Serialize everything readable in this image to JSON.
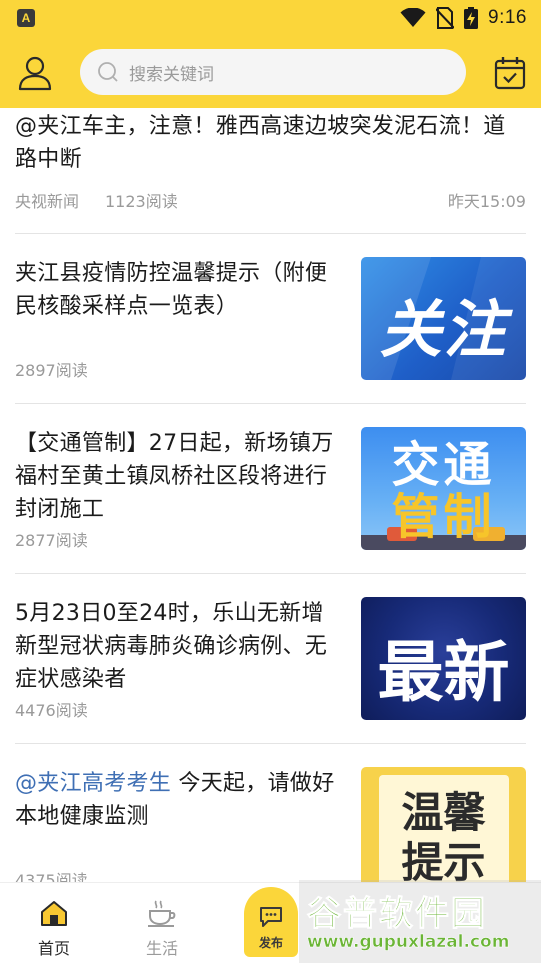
{
  "status_bar": {
    "app_icon_letter": "A",
    "time": "9:16",
    "icons": [
      "wifi-icon",
      "no-sim-icon",
      "battery-charging-icon"
    ]
  },
  "header": {
    "search_placeholder": "搜索关键词"
  },
  "news": [
    {
      "title": "@夹江车主，注意！雅西高速边坡突发泥石流！道路中断",
      "source": "央视新闻",
      "reads": "1123阅读",
      "time": "昨天15:09"
    },
    {
      "title": "夹江县疫情防控温馨提示（附便民核酸采样点一览表）",
      "reads": "2897阅读",
      "thumb_text": "关注"
    },
    {
      "title": "【交通管制】27日起，新场镇万福村至黄土镇凤桥社区段将进行封闭施工",
      "reads": "2877阅读",
      "thumb_line1": "交通",
      "thumb_line2": "管制"
    },
    {
      "title": "5月23日0至24时，乐山无新增新型冠状病毒肺炎确诊病例、无症状感染者",
      "reads": "4476阅读",
      "thumb_text": "最新"
    },
    {
      "title_tag": "@夹江高考考生",
      "title_rest": " 今天起，请做好本地健康监测",
      "reads": "4375阅读",
      "thumb_line1": "温馨",
      "thumb_line2": "提示"
    }
  ],
  "bottom_nav": {
    "items": [
      {
        "label": "首页",
        "icon": "home-icon",
        "active": true
      },
      {
        "label": "生活",
        "icon": "coffee-cup-icon",
        "active": false
      }
    ],
    "publish_label": "发布"
  },
  "watermark": {
    "title": "谷普软件园",
    "url": "www.gupuxlazal.com"
  },
  "colors": {
    "brand_yellow": "#fbd63a",
    "link_blue": "#3f6fb4",
    "muted_text": "#9a9a9a"
  }
}
